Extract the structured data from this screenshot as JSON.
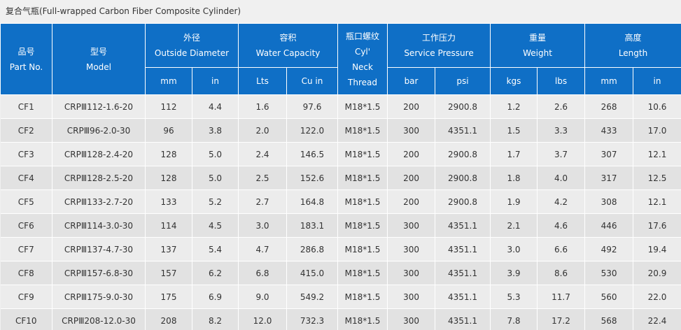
{
  "title": "复合气瓶(Full-wrapped Carbon Fiber Composite Cylinder)",
  "headers": {
    "part_no": {
      "cn": "品号",
      "en": "Part No."
    },
    "model": {
      "cn": "型号",
      "en": "Model"
    },
    "outside_diameter": {
      "cn": "外径",
      "en": "Outside Diameter",
      "units": [
        "mm",
        "in"
      ]
    },
    "water_capacity": {
      "cn": "容积",
      "en": "Water Capacity",
      "units": [
        "Lts",
        "Cu in"
      ]
    },
    "thread": {
      "cn": "瓶口螺纹",
      "en1": "Cyl'",
      "en2": "Neck",
      "en3": "Thread"
    },
    "service_pressure": {
      "cn": "工作压力",
      "en": "Service Pressure",
      "units": [
        "bar",
        "psi"
      ]
    },
    "weight": {
      "cn": "重量",
      "en": "Weight",
      "units": [
        "kgs",
        "lbs"
      ]
    },
    "length": {
      "cn": "高度",
      "en": "Length",
      "units": [
        "mm",
        "in"
      ]
    }
  },
  "rows": [
    [
      "CF1",
      "CRPⅢ112-1.6-20",
      "112",
      "4.4",
      "1.6",
      "97.6",
      "M18*1.5",
      "200",
      "2900.8",
      "1.2",
      "2.6",
      "268",
      "10.6"
    ],
    [
      "CF2",
      "CRPⅢ96-2.0-30",
      "96",
      "3.8",
      "2.0",
      "122.0",
      "M18*1.5",
      "300",
      "4351.1",
      "1.5",
      "3.3",
      "433",
      "17.0"
    ],
    [
      "CF3",
      "CRPⅢ128-2.4-20",
      "128",
      "5.0",
      "2.4",
      "146.5",
      "M18*1.5",
      "200",
      "2900.8",
      "1.7",
      "3.7",
      "307",
      "12.1"
    ],
    [
      "CF4",
      "CRPⅢ128-2.5-20",
      "128",
      "5.0",
      "2.5",
      "152.6",
      "M18*1.5",
      "200",
      "2900.8",
      "1.8",
      "4.0",
      "317",
      "12.5"
    ],
    [
      "CF5",
      "CRPⅢ133-2.7-20",
      "133",
      "5.2",
      "2.7",
      "164.8",
      "M18*1.5",
      "200",
      "2900.8",
      "1.9",
      "4.2",
      "308",
      "12.1"
    ],
    [
      "CF6",
      "CRPⅢ114-3.0-30",
      "114",
      "4.5",
      "3.0",
      "183.1",
      "M18*1.5",
      "300",
      "4351.1",
      "2.1",
      "4.6",
      "446",
      "17.6"
    ],
    [
      "CF7",
      "CRPⅢ137-4.7-30",
      "137",
      "5.4",
      "4.7",
      "286.8",
      "M18*1.5",
      "300",
      "4351.1",
      "3.0",
      "6.6",
      "492",
      "19.4"
    ],
    [
      "CF8",
      "CRPⅢ157-6.8-30",
      "157",
      "6.2",
      "6.8",
      "415.0",
      "M18*1.5",
      "300",
      "4351.1",
      "3.9",
      "8.6",
      "530",
      "20.9"
    ],
    [
      "CF9",
      "CRPⅢ175-9.0-30",
      "175",
      "6.9",
      "9.0",
      "549.2",
      "M18*1.5",
      "300",
      "4351.1",
      "5.3",
      "11.7",
      "560",
      "22.0"
    ],
    [
      "CF10",
      "CRPⅢ208-12.0-30",
      "208",
      "8.2",
      "12.0",
      "732.3",
      "M18*1.5",
      "300",
      "4351.1",
      "7.8",
      "17.2",
      "568",
      "22.4"
    ]
  ]
}
